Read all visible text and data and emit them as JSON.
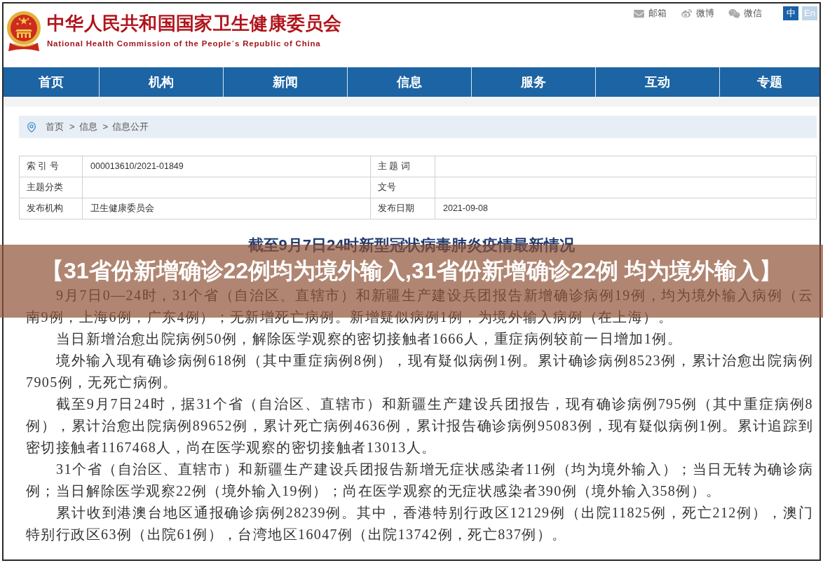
{
  "header": {
    "title": "中华人民共和国国家卫生健康委员会",
    "subtitle": "National Health Commission of the People´s Republic of China",
    "links": [
      {
        "kind": "mail",
        "label": "邮箱"
      },
      {
        "kind": "weibo",
        "label": "微博"
      },
      {
        "kind": "wechat",
        "label": "微信"
      }
    ],
    "languages": [
      {
        "label": "中",
        "selected": true
      },
      {
        "label": "En",
        "selected": false
      }
    ]
  },
  "nav": {
    "items": [
      {
        "label": "首页"
      },
      {
        "label": "机构"
      },
      {
        "label": "新闻"
      },
      {
        "label": "信息"
      },
      {
        "label": "服务"
      },
      {
        "label": "互动"
      },
      {
        "label": "专题"
      }
    ]
  },
  "breadcrumb": {
    "items": [
      {
        "label": "首页"
      },
      {
        "separator": ">",
        "label": "信息"
      },
      {
        "separator": ">",
        "label": "信息公开"
      }
    ]
  },
  "info_table": {
    "rows": [
      {
        "cells": [
          {
            "label": "索 引 号",
            "value": "000013610/2021-01849"
          },
          {
            "label": "主 题 词"
          }
        ]
      },
      {
        "cells": [
          {
            "label": "主题分类"
          },
          {
            "label": "文号"
          }
        ]
      },
      {
        "cells": [
          {
            "label": "发布机构",
            "value": "卫生健康委员会"
          },
          {
            "label": "发布日期",
            "value": "2021-09-08"
          }
        ]
      }
    ]
  },
  "article": {
    "title": "截至9月7日24时新型冠状病毒肺炎疫情最新情况",
    "paragraphs": [
      "9月7日0—24时，31个省（自治区、直辖市）和新疆生产建设兵团报告新增确诊病例19例，均为境外输入病例（云南9例，上海6例，广东4例）；无新增死亡病例。新增疑似病例1例，为境外输入病例（在上海）。",
      "当日新增治愈出院病例50例，解除医学观察的密切接触者1666人，重症病例较前一日增加1例。",
      "境外输入现有确诊病例618例（其中重症病例8例），现有疑似病例1例。累计确诊病例8523例，累计治愈出院病例7905例，无死亡病例。",
      "截至9月7日24时，据31个省（自治区、直辖市）和新疆生产建设兵团报告，现有确诊病例795例（其中重症病例8例），累计治愈出院病例89652例，累计死亡病例4636例，累计报告确诊病例95083例，现有疑似病例1例。累计追踪到密切接触者1167468人，尚在医学观察的密切接触者13013人。",
      "31个省（自治区、直辖市）和新疆生产建设兵团报告新增无症状感染者11例（均为境外输入）；当日无转为确诊病例；当日解除医学观察22例（境外输入19例）；尚在医学观察的无症状感染者390例（境外输入358例）。",
      "累计收到港澳台地区通报确诊病例28239例。其中，香港特别行政区12129例（出院11825例，死亡212例），澳门特别行政区63例（出院61例），台湾地区16047例（出院13742例，死亡837例）。"
    ]
  },
  "overlay_banner": {
    "text": "【31省份新增确诊22例均为境外输入,31省份新增确诊22例 均为境外输入】"
  }
}
